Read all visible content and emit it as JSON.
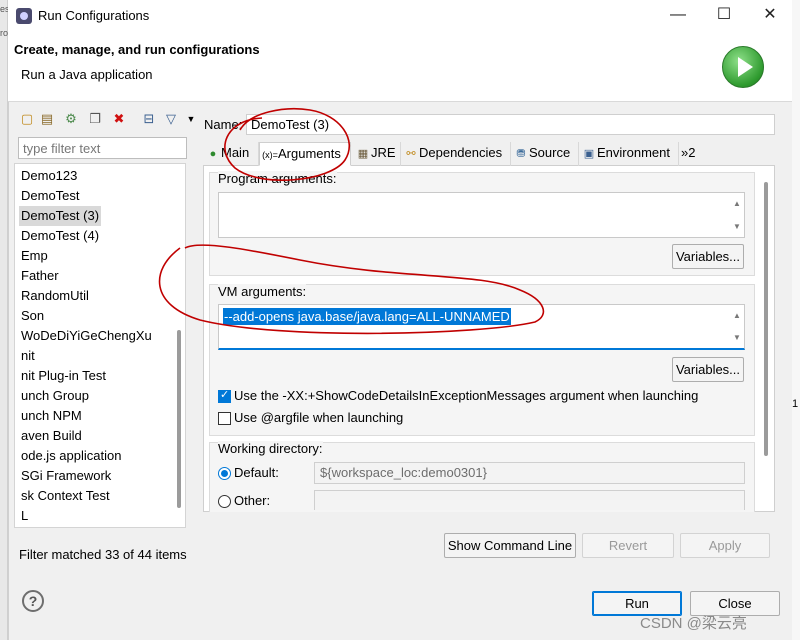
{
  "window": {
    "title": "Run Configurations",
    "header_title": "Create, manage, and run configurations",
    "header_subtitle": "Run a Java application",
    "minimize_symbol": "—",
    "maximize_symbol": "☐",
    "close_symbol": "✕"
  },
  "behind_text": [
    "es",
    "ro"
  ],
  "behind_right_text": "1",
  "left": {
    "toolbar_icons": [
      "new-config-icon",
      "new-prototype-icon",
      "export-icon",
      "duplicate-icon",
      "delete-icon",
      "collapse-all-icon",
      "filter-icon",
      "dropdown-arrow-icon"
    ],
    "filter_placeholder": "type filter text",
    "tree_items": [
      "Demo123",
      "DemoTest",
      "DemoTest (3)",
      "DemoTest (4)",
      "Emp",
      "Father",
      "RandomUtil",
      "Son",
      "WoDeDiYiGeChengXu",
      "nit",
      "nit Plug-in Test",
      "unch Group",
      "unch NPM",
      "aven Build",
      "ode.js application",
      "SGi Framework",
      "sk Context Test",
      "L"
    ],
    "selected_index": 2,
    "filter_status": "Filter matched 33 of 44 items"
  },
  "config": {
    "name_label": "Name:",
    "name_value": "DemoTest (3)",
    "tabs": [
      {
        "label": "Main",
        "icon": "main-icon"
      },
      {
        "label": "Arguments",
        "icon": "arguments-icon"
      },
      {
        "label": "JRE",
        "icon": "jre-icon"
      },
      {
        "label": "Dependencies",
        "icon": "dependencies-icon"
      },
      {
        "label": "Source",
        "icon": "source-icon"
      },
      {
        "label": "Environment",
        "icon": "environment-icon"
      },
      {
        "label": "»2",
        "icon": ""
      }
    ],
    "active_tab": "Arguments",
    "program_args_label": "Program arguments:",
    "program_args_value": "",
    "variables_label": "Variables...",
    "vm_args_label": "VM arguments:",
    "vm_args_value": "--add-opens java.base/java.lang=ALL-UNNAMED",
    "checkbox_showcode_label": "Use the -XX:+ShowCodeDetailsInExceptionMessages argument when launching",
    "checkbox_showcode_checked": true,
    "checkbox_argfile_label": "Use @argfile when launching",
    "checkbox_argfile_checked": false,
    "working_dir_label": "Working directory:",
    "default_label": "Default:",
    "default_value": "${workspace_loc:demo0301}",
    "other_label": "Other:",
    "other_value": ""
  },
  "buttons": {
    "show_command_line": "Show Command Line",
    "revert": "Revert",
    "apply": "Apply",
    "run": "Run",
    "close": "Close",
    "help_symbol": "?"
  },
  "watermark": "CSDN @梁云亮",
  "colors": {
    "selection": "#0078d7",
    "annotation": "#c00000",
    "run_green": "#2e9a2e"
  }
}
